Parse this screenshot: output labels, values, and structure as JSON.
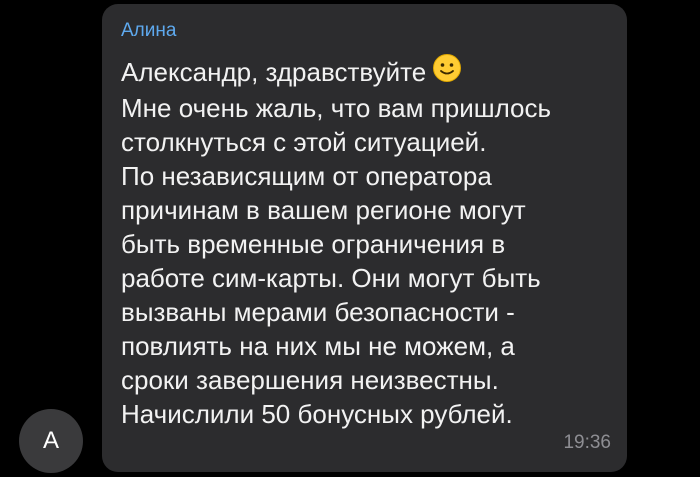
{
  "chat": {
    "avatar_initial": "А",
    "sender_name": "Алина",
    "message_lines": [
      "Александр, здравствуйте",
      "Мне очень жаль, что вам пришлось",
      "столкнуться с этой ситуацией.",
      "По независящим от оператора",
      "причинам в вашем регионе могут",
      "быть временные ограничения в",
      "работе сим-карты. Они могут быть",
      "вызваны мерами безопасности -",
      "повлиять на них мы не можем, а",
      "сроки завершения неизвестны.",
      "Начислили 50 бонусных рублей."
    ],
    "time": "19:36",
    "emoji_icon": "slightly-smiling-face"
  },
  "colors": {
    "background": "#000000",
    "bubble": "#2c2c2e",
    "sender_name": "#5ea9ee",
    "message_text": "#f2f2f2",
    "timestamp": "#8e8e93",
    "avatar_bg": "#3a3a3c"
  }
}
